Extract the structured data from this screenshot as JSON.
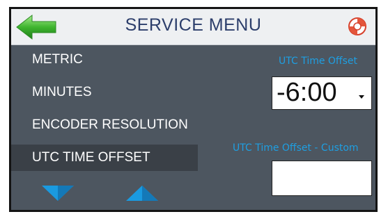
{
  "header": {
    "title": "SERVICE MENU",
    "back_icon": "back-arrow-icon",
    "help_icon": "lifebuoy-icon"
  },
  "menu": {
    "items": [
      {
        "label": "METRIC",
        "selected": false
      },
      {
        "label": "MINUTES",
        "selected": false
      },
      {
        "label": "ENCODER RESOLUTION",
        "selected": false
      },
      {
        "label": "UTC TIME OFFSET",
        "selected": true
      }
    ],
    "scroll_down_icon": "triangle-down-icon",
    "scroll_up_icon": "triangle-up-icon"
  },
  "settings": {
    "utc_offset_label": "UTC Time Offset",
    "utc_offset_value": "-6:00",
    "utc_custom_label": "UTC Time Offset - Custom",
    "utc_custom_value": ""
  },
  "colors": {
    "panel": "#4d5660",
    "selected_row": "#3a4047",
    "accent_blue": "#1e9fe2",
    "title_text": "#2c3e6b",
    "back_arrow_green": "#3fb52f"
  }
}
